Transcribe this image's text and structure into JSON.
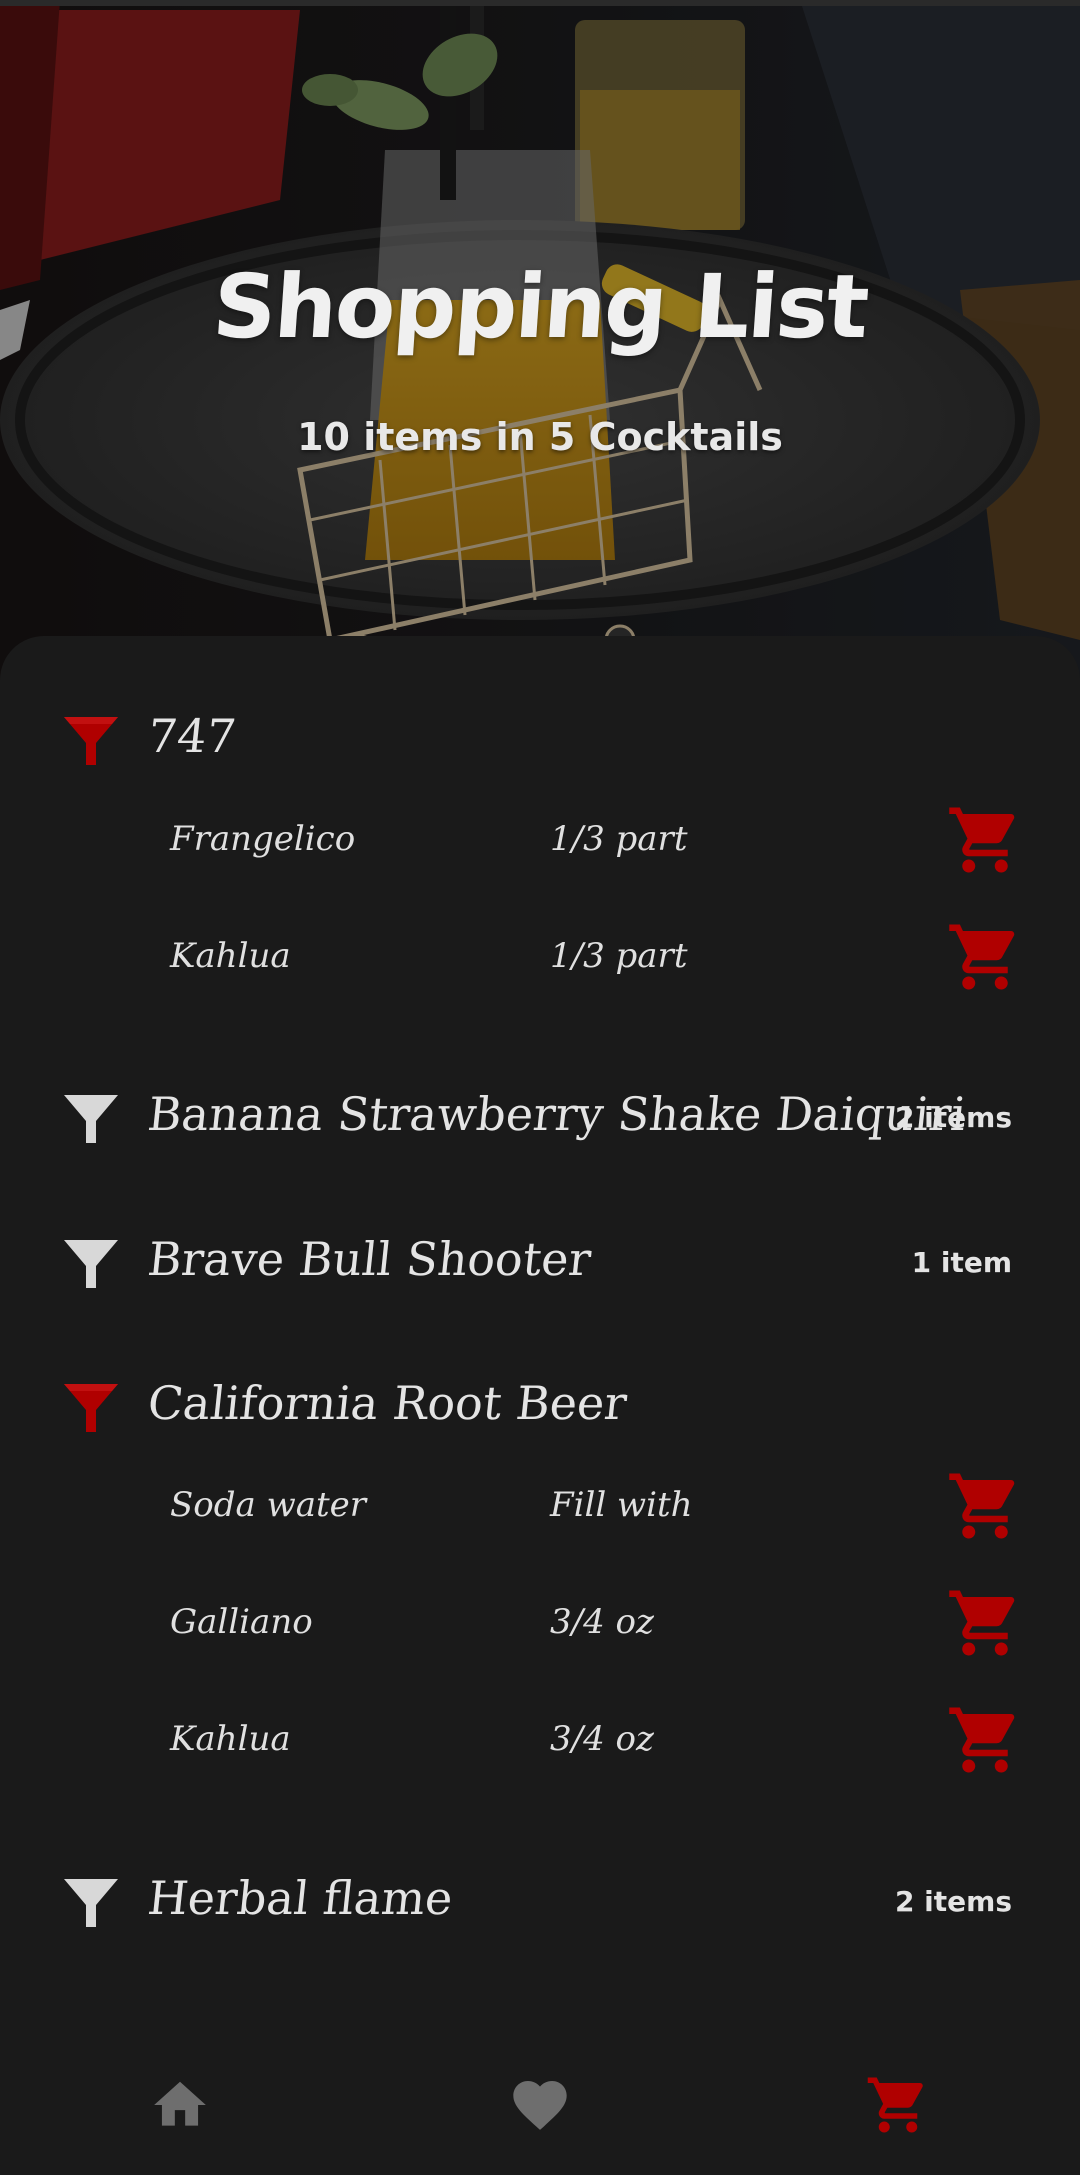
{
  "header": {
    "title": "Shopping List",
    "subtitle": "10 items in 5 Cocktails"
  },
  "colors": {
    "accent": "#b00000",
    "background": "#1a1a1a",
    "text": "#e4e4e4",
    "icon_muted": "#d8d8d8",
    "nav_inactive": "#6e6e6e"
  },
  "cocktails": [
    {
      "name": "747",
      "icon": "cocktail-glass-icon",
      "expanded": true,
      "count": "",
      "ingredients": [
        {
          "name": "Frangelico",
          "quantity": "1/3 part"
        },
        {
          "name": "Kahlua",
          "quantity": "1/3 part"
        }
      ]
    },
    {
      "name": "Banana Strawberry Shake Daiquiri",
      "icon": "cocktail-glass-icon",
      "expanded": false,
      "count": "2 items",
      "ingredients": []
    },
    {
      "name": "Brave Bull Shooter",
      "icon": "cocktail-glass-icon",
      "expanded": false,
      "count": "1 item",
      "ingredients": []
    },
    {
      "name": "California Root Beer",
      "icon": "cocktail-glass-icon",
      "expanded": true,
      "count": "",
      "ingredients": [
        {
          "name": "Soda water",
          "quantity": "Fill with"
        },
        {
          "name": "Galliano",
          "quantity": "3/4 oz"
        },
        {
          "name": "Kahlua",
          "quantity": "3/4 oz"
        }
      ]
    },
    {
      "name": "Herbal flame",
      "icon": "cocktail-glass-icon",
      "expanded": false,
      "count": "2 items",
      "ingredients": []
    }
  ],
  "bottom_nav": {
    "items": [
      {
        "name": "home",
        "icon": "home-icon",
        "active": false
      },
      {
        "name": "favorites",
        "icon": "heart-icon",
        "active": false
      },
      {
        "name": "shopping-list",
        "icon": "shopping-cart-icon",
        "active": true
      }
    ]
  }
}
